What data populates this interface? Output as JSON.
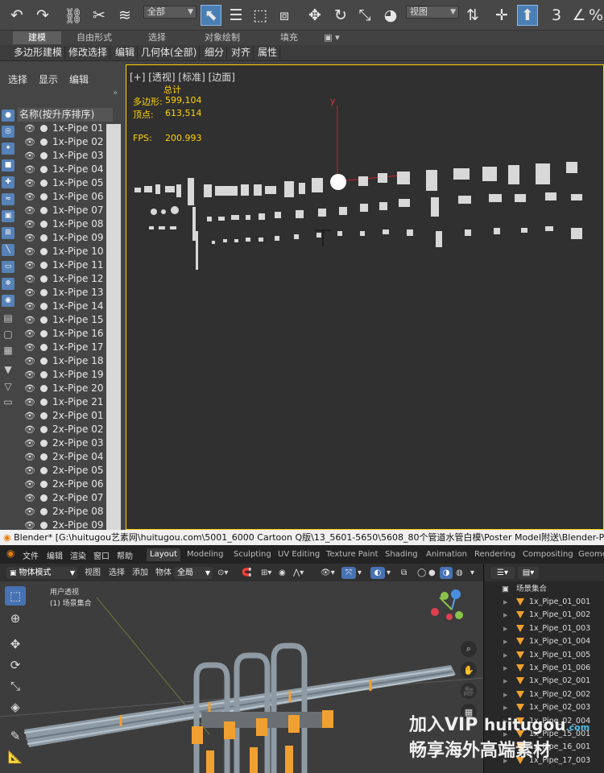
{
  "max": {
    "toolbar": {
      "filter_dropdown": "全部",
      "viewport_dropdown": "视图",
      "snap_label": "3"
    },
    "ribbon_tabs": [
      {
        "label": "建模",
        "active": true
      },
      {
        "label": "自由形式",
        "active": false
      },
      {
        "label": "选择",
        "active": false
      },
      {
        "label": "对象绘制",
        "active": false
      },
      {
        "label": "填充",
        "active": false
      }
    ],
    "sub_buttons": [
      "多边形建模",
      "修改选择",
      "编辑",
      "几何体(全部)",
      "细分",
      "对齐",
      "属性"
    ],
    "explorer": {
      "menu": [
        "选择",
        "显示",
        "编辑"
      ],
      "column_header": "名称(按升序排序)",
      "items": [
        "1x-Pipe 01",
        "1x-Pipe 02",
        "1x-Pipe 03",
        "1x-Pipe 04",
        "1x-Pipe 05",
        "1x-Pipe 06",
        "1x-Pipe 07",
        "1x-Pipe 08",
        "1x-Pipe 09",
        "1x-Pipe 10",
        "1x-Pipe 11",
        "1x-Pipe 12",
        "1x-Pipe 13",
        "1x-Pipe 14",
        "1x-Pipe 15",
        "1x-Pipe 16",
        "1x-Pipe 17",
        "1x-Pipe 18",
        "1x-Pipe 19",
        "1x-Pipe 20",
        "1x-Pipe 21",
        "2x-Pipe 01",
        "2x-Pipe 02",
        "2x-Pipe 03",
        "2x-Pipe 04",
        "2x-Pipe 05",
        "2x-Pipe 06",
        "2x-Pipe 07",
        "2x-Pipe 08",
        "2x-Pipe 09"
      ]
    },
    "viewport": {
      "label": "[+] [透视] [标准] [边面]",
      "stats_title": "总计",
      "poly_label": "多边形:",
      "poly_value": "599,104",
      "vert_label": "顶点:",
      "vert_value": "613,514",
      "fps_label": "FPS:",
      "fps_value": "200.993",
      "axis_y": "y"
    }
  },
  "blender": {
    "title": "Blender* [G:\\huitugou艺素网\\huitugou.com\\5001_6000 Cartoon Q版\\13_5601-5650\\5608_80个管道水管白模\\Poster Model附送\\Blender-Poster Model\\Blender-",
    "menu": [
      "文件",
      "编辑",
      "渲染",
      "窗口",
      "帮助"
    ],
    "workspaces": [
      {
        "label": "Layout",
        "active": true
      },
      {
        "label": "Modeling",
        "active": false
      },
      {
        "label": "Sculpting",
        "active": false
      },
      {
        "label": "UV Editing",
        "active": false
      },
      {
        "label": "Texture Paint",
        "active": false
      },
      {
        "label": "Shading",
        "active": false
      },
      {
        "label": "Animation",
        "active": false
      },
      {
        "label": "Rendering",
        "active": false
      },
      {
        "label": "Compositing",
        "active": false
      },
      {
        "label": "Geome",
        "active": false
      }
    ],
    "header": {
      "mode": "物体模式",
      "view": "视图",
      "select": "选择",
      "add": "添加",
      "object": "物体",
      "transform": "全局"
    },
    "viewport_text": {
      "line1": "用户透视",
      "line2": "(1) 场景集合"
    },
    "outliner": {
      "root": "场景集合",
      "items": [
        "1x_Pipe_01_001",
        "1x_Pipe_01_002",
        "1x_Pipe_01_003",
        "1x_Pipe_01_004",
        "1x_Pipe_01_005",
        "1x_Pipe_01_006",
        "1x_Pipe_02_001",
        "1x_Pipe_02_002",
        "1x_Pipe_02_003",
        "1x_Pipe_02_004",
        "1x_Pipe_15_001",
        "1x_Pipe_16_001",
        "1x_Pipe_17_003"
      ]
    }
  },
  "watermark": {
    "line1": "加入VIP",
    "brand": "huitugou",
    "brand_sub": ".com",
    "line2": "畅享海外高端素材"
  },
  "colors": {
    "max_accent": "#ffd200",
    "blender_accent": "#4772b3",
    "mesh_orange": "#f0a030"
  }
}
